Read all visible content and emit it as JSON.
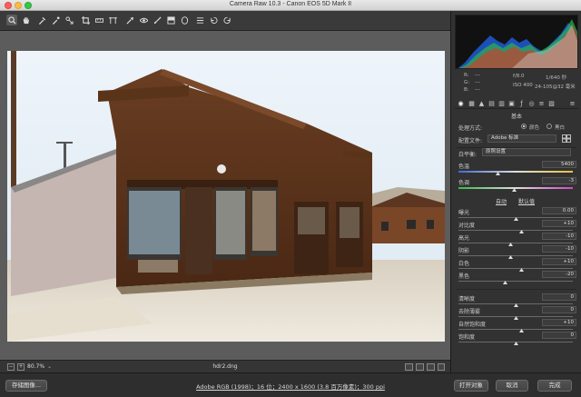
{
  "window": {
    "title": "Camera Raw 10.3 -  Canon EOS 5D Mark II"
  },
  "toolbar": {
    "tools": [
      "zoom-icon",
      "hand-icon",
      "white-balance-icon",
      "color-sampler-icon",
      "crop-icon",
      "straighten-icon",
      "transform-icon",
      "spot-removal-icon",
      "red-eye-icon",
      "adjustment-brush-icon",
      "graduated-filter-icon",
      "radial-filter-icon",
      "preferences-icon",
      "rotate-left-icon",
      "rotate-right-icon"
    ],
    "active_tool": "zoom-icon"
  },
  "canvas": {
    "zoom": "80.7%",
    "filename": "hdr2.dng"
  },
  "footer": {
    "save_label": "存储图像...",
    "workflow": "Adobe RGB (1998)；16 位；2400 x 1600 (3.8 百万像素)；300 ppi",
    "open_label": "打开对象",
    "cancel_label": "取消",
    "done_label": "完成"
  },
  "info": {
    "r_label": "R:",
    "g_label": "G:",
    "b_label": "B:",
    "r_val": "---",
    "g_val": "---",
    "b_val": "---",
    "aperture": "f/8.0",
    "shutter": "1/640 秒",
    "iso": "ISO 400",
    "lens": "24-105@32 毫米"
  },
  "panel": {
    "section_title": "基本",
    "treatment_label": "处理方式:",
    "treatment_color": "颜色",
    "treatment_bw": "黑白",
    "profile_label": "配置文件:",
    "profile_value": "Adobe 标准",
    "wb_label": "白平衡:",
    "wb_value": "原照设置",
    "auto_label": "自动",
    "default_label": "默认值",
    "sliders": [
      {
        "label": "色温",
        "value": "5400"
      },
      {
        "label": "色调",
        "value": "-3"
      },
      {
        "label": "曝光",
        "value": "0.00"
      },
      {
        "label": "对比度",
        "value": "+10"
      },
      {
        "label": "高光",
        "value": "-10"
      },
      {
        "label": "阴影",
        "value": "-10"
      },
      {
        "label": "白色",
        "value": "+10"
      },
      {
        "label": "黑色",
        "value": "-20"
      },
      {
        "label": "清晰度",
        "value": "0"
      },
      {
        "label": "去除薄雾",
        "value": "0"
      },
      {
        "label": "自然饱和度",
        "value": "+10"
      },
      {
        "label": "饱和度",
        "value": "0"
      }
    ]
  },
  "colors": {
    "panel_bg": "#323232",
    "canvas_bg": "#5c5c5c"
  }
}
